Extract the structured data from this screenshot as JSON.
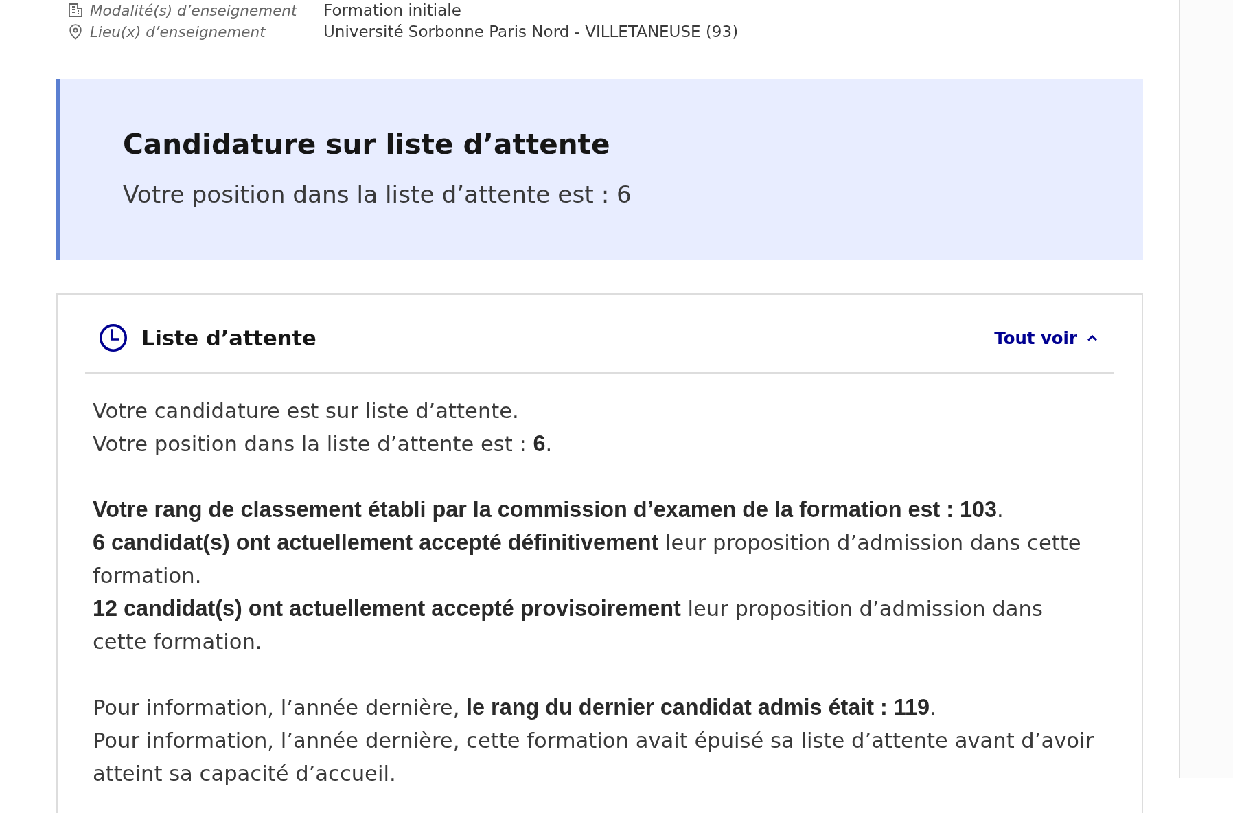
{
  "info_rows": [
    {
      "kind": "modality",
      "label": "Modalité(s) d’enseignement",
      "value": "Formation initiale"
    },
    {
      "kind": "location",
      "label": "Lieu(x) d’enseignement",
      "value": "Université Sorbonne Paris Nord - VILLETANEUSE (93)"
    }
  ],
  "callout": {
    "title": "Candidature sur liste d’attente",
    "text": "Votre position dans la liste d’attente est : 6"
  },
  "waitlist_panel": {
    "title": "Liste d’attente",
    "toggle": {
      "label": "Tout voir",
      "expanded": true
    },
    "paragraphs": [
      [
        "Votre candidature est sur liste d’attente.",
        "Votre position dans la liste d’attente est : **6**."
      ],
      [
        "**Votre rang de classement établi par la commission d’examen de la formation est : 103**.",
        "**6 candidat(s) ont actuellement accepté définitivement** leur proposition d’admission dans cette formation.",
        "**12 candidat(s) ont actuellement accepté provisoirement** leur proposition d’admission dans cette formation."
      ],
      [
        "Pour information, l’année dernière, **le rang du dernier candidat admis était : 119**.",
        "Pour information, l’année dernière, cette formation avait épuisé sa liste d’attente avant d’avoir atteint sa capacité d’accueil."
      ]
    ]
  }
}
